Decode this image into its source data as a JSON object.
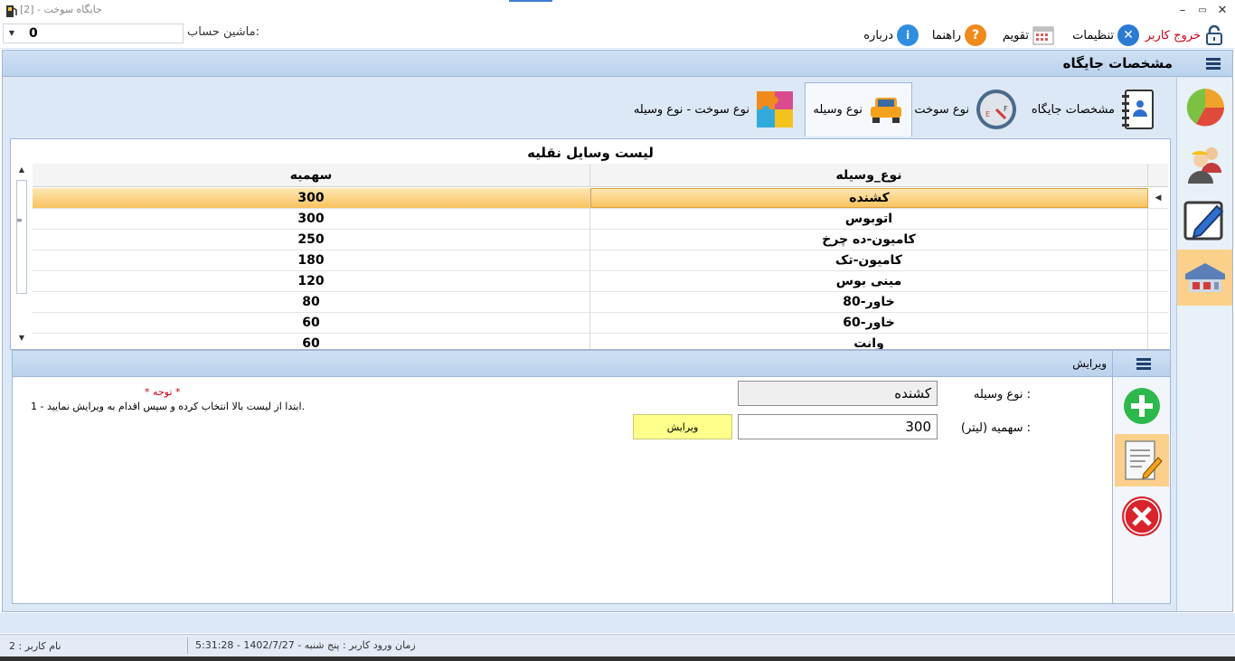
{
  "window": {
    "title": "[جایگاه سوخت - [2",
    "controls": {
      "minimize": "–",
      "restore": "▭",
      "close": "✕"
    }
  },
  "toolbar": {
    "account_label": "ماشین حساب:",
    "account_value": "0",
    "items": [
      {
        "label": "خروج کاربر",
        "icon": "lock-icon",
        "color": "#d0001a"
      },
      {
        "label": "تنظیمات",
        "icon": "tools-icon"
      },
      {
        "label": "تقویم",
        "icon": "calendar-icon"
      },
      {
        "label": "راهنما",
        "icon": "help-icon"
      },
      {
        "label": "درباره",
        "icon": "info-icon"
      }
    ]
  },
  "header": {
    "title": "مشخصات جایگاه"
  },
  "side_nav": {
    "items": [
      {
        "icon": "pie-chart-icon",
        "active": false
      },
      {
        "icon": "users-icon",
        "active": false
      },
      {
        "icon": "pencil-icon",
        "active": false
      },
      {
        "icon": "station-icon",
        "active": true
      }
    ]
  },
  "tabs": [
    {
      "label": "مشخصات جایگاه",
      "icon": "notebook-icon",
      "active": false
    },
    {
      "label": "نوع سوخت",
      "icon": "fuel-gauge-icon",
      "active": false
    },
    {
      "label": "نوع وسیله",
      "icon": "car-icon",
      "active": true
    },
    {
      "label": "نوع سوخت - نوع وسیله",
      "icon": "puzzle-icon",
      "active": false
    }
  ],
  "list": {
    "caption": "لیست وسایل نقلیه",
    "columns": {
      "vehicle_type": "نوع_وسیله",
      "quota": "سهمیه"
    },
    "rows": [
      {
        "vehicle_type": "کشنده",
        "quota": "300",
        "selected": true
      },
      {
        "vehicle_type": "اتوبوس",
        "quota": "300"
      },
      {
        "vehicle_type": "کامیون-ده چرخ",
        "quota": "250"
      },
      {
        "vehicle_type": "کامیون-تک",
        "quota": "180"
      },
      {
        "vehicle_type": "مینی بوس",
        "quota": "120"
      },
      {
        "vehicle_type": "خاور-80",
        "quota": "80"
      },
      {
        "vehicle_type": "خاور-60",
        "quota": "60"
      },
      {
        "vehicle_type": "وانت",
        "quota": "60"
      }
    ]
  },
  "edit": {
    "title": "ویرایش",
    "vehicle_type_label": "نوع وسیله :",
    "vehicle_type_value": "کشنده",
    "quota_label": "سهمیه (لیتر) :",
    "quota_value": "300",
    "edit_button": "ویرایش",
    "note_title": "* توجه *",
    "note_text": "1 - ابتدا از لیست بالا  انتخاب کرده و سپس اقدام به ویرایش نمایید."
  },
  "statusbar": {
    "user": "نام کاربر : 2",
    "login_time": "زمان ورود کاربر : پنج شنبه - 1402/7/27 - 5:31:28"
  },
  "colors": {
    "accent": "#3e7fd1",
    "selection": "#f9c35f",
    "panel": "#dce8f5",
    "button_yellow": "#ffff8c",
    "add_green": "#2db84b",
    "delete_red": "#d9242b"
  }
}
